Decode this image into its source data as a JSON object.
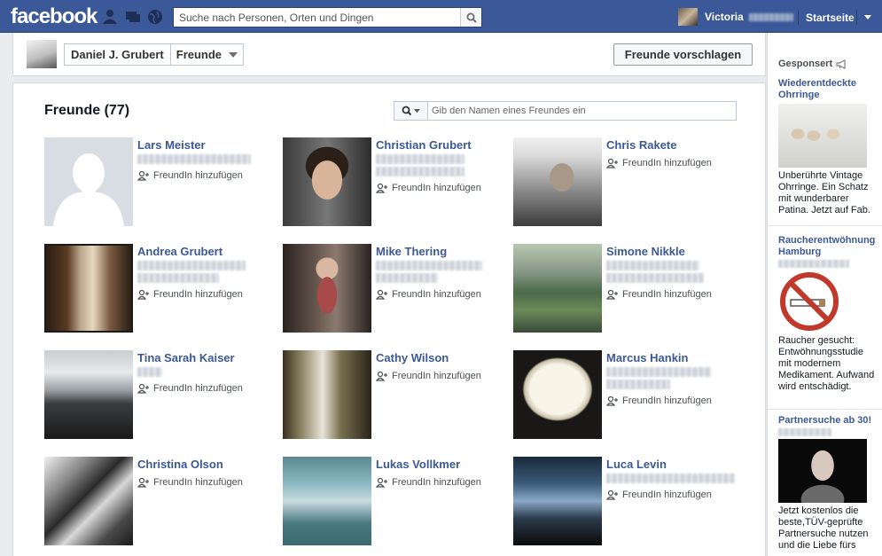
{
  "topbar": {
    "logo": "facebook",
    "search_placeholder": "Suche nach Personen, Orten und Dingen",
    "user_name": "Victoria",
    "home_label": "Startseite"
  },
  "header": {
    "profile_name": "Daniel J. Grubert",
    "section": "Freunde",
    "suggest_button": "Freunde vorschlagen"
  },
  "friends_panel": {
    "title": "Freunde (77)",
    "search_placeholder": "Gib den Namen eines Freundes ein",
    "add_label": "FreundIn hinzufügen",
    "friends": [
      {
        "name": "Lars Meister"
      },
      {
        "name": "Christian Grubert"
      },
      {
        "name": "Chris Rakete"
      },
      {
        "name": "Andrea Grubert"
      },
      {
        "name": "Mike Thering"
      },
      {
        "name": "Simone Nikkle"
      },
      {
        "name": "Tina Sarah Kaiser"
      },
      {
        "name": "Cathy Wilson"
      },
      {
        "name": "Marcus Hankin"
      },
      {
        "name": "Christina Olson"
      },
      {
        "name": "Lukas Vollkmer"
      },
      {
        "name": "Luca Levin"
      }
    ]
  },
  "sidebar": {
    "sponsored_label": "Gesponsert",
    "ads": [
      {
        "title": "Wiederentdeckte Ohrringe",
        "body": "Unberührte Vintage Ohrringe. Ein Schatz mit wunderbarer Patina. Jetzt auf Fab."
      },
      {
        "title": "Raucherentwöhnung Hamburg",
        "body": "Raucher gesucht: Entwöhnungsstudie mit modernem Medikament. Aufwand wird entschädigt."
      },
      {
        "title": "Partnersuche ab 30!",
        "body": "Jetzt kostenlos die beste,TÜV-geprüfte Partnersuche nutzen und die Liebe fürs"
      }
    ]
  }
}
